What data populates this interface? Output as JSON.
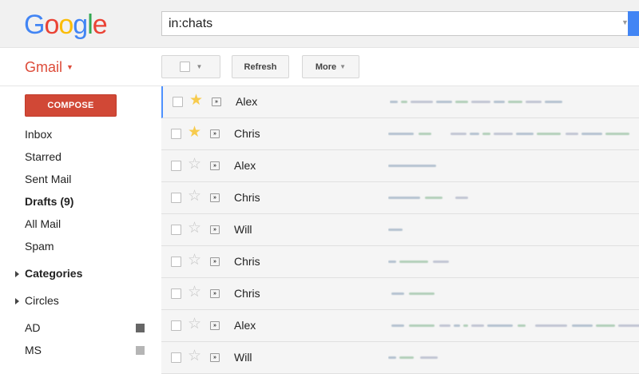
{
  "logo": {
    "letters": [
      "G",
      "o",
      "o",
      "g",
      "l",
      "e"
    ],
    "colors": [
      "#4285f4",
      "#ea4335",
      "#fbbc05",
      "#4285f4",
      "#34a853",
      "#ea4335"
    ]
  },
  "search": {
    "value": "in:chats",
    "dropdown_icon": "caret-down-icon"
  },
  "app": {
    "name": "Gmail",
    "accent": "#dd4b39"
  },
  "toolbar": {
    "refresh_label": "Refresh",
    "more_label": "More"
  },
  "sidebar": {
    "compose_label": "COMPOSE",
    "items": [
      {
        "label": "Inbox"
      },
      {
        "label": "Starred"
      },
      {
        "label": "Sent Mail"
      },
      {
        "label": "Drafts (9)"
      },
      {
        "label": "All Mail"
      },
      {
        "label": "Spam"
      },
      {
        "label": "Categories"
      },
      {
        "label": "Circles"
      },
      {
        "label": "AD",
        "color": "#666666"
      },
      {
        "label": "MS",
        "color": "#b5b5b5"
      }
    ]
  },
  "messages": [
    {
      "sender": "Alex",
      "starred": true
    },
    {
      "sender": "Chris",
      "starred": true
    },
    {
      "sender": "Alex",
      "starred": false
    },
    {
      "sender": "Chris",
      "starred": false
    },
    {
      "sender": "Will",
      "starred": false
    },
    {
      "sender": "Chris",
      "starred": false
    },
    {
      "sender": "Chris",
      "starred": false
    },
    {
      "sender": "Alex",
      "starred": false
    },
    {
      "sender": "Will",
      "starred": false
    }
  ]
}
